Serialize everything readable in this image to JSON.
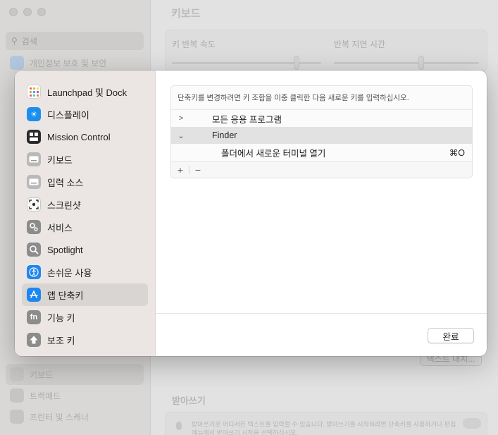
{
  "background": {
    "title": "키보드",
    "search_placeholder": "검색",
    "sidebar_top_item": "개인정보 보호 및 보안",
    "sidebar_bottom_items": [
      "키보드",
      "트랙패드",
      "프린터 및 스캐너"
    ],
    "key_repeat_label": "키 반복 속도",
    "repeat_delay_label": "반복 지연 시간",
    "text_replace_button": "텍스트 대치...",
    "dictation_section": "받아쓰기",
    "dictation_text": "받아쓰기로 어디서든 텍스트를 입력할 수 있습니다. 받아쓰기를 시작하려면 단축키를 사용하거나 편집 메뉴에서 받아쓰기 시작을 선택하십시오."
  },
  "sidebar": {
    "items": [
      {
        "label": "Launchpad 및 Dock",
        "icon": "launchpad-icon",
        "selected": false
      },
      {
        "label": "디스플레이",
        "icon": "display-icon",
        "selected": false
      },
      {
        "label": "Mission Control",
        "icon": "mission-control-icon",
        "selected": false
      },
      {
        "label": "키보드",
        "icon": "keyboard-icon",
        "selected": false
      },
      {
        "label": "입력 소스",
        "icon": "input-sources-icon",
        "selected": false
      },
      {
        "label": "스크린샷",
        "icon": "screenshot-icon",
        "selected": false
      },
      {
        "label": "서비스",
        "icon": "services-icon",
        "selected": false
      },
      {
        "label": "Spotlight",
        "icon": "spotlight-icon",
        "selected": false
      },
      {
        "label": "손쉬운 사용",
        "icon": "accessibility-icon",
        "selected": false
      },
      {
        "label": "앱 단축키",
        "icon": "app-shortcuts-icon",
        "selected": true
      },
      {
        "label": "기능 키",
        "icon": "function-keys-icon",
        "selected": false
      },
      {
        "label": "보조 키",
        "icon": "modifier-keys-icon",
        "selected": false
      }
    ],
    "fn_glyph": "fn"
  },
  "shortcuts": {
    "hint": "단축키를 변경하려면 키 조합을 이중 클릭한 다음 새로운 키를 입력하십시오.",
    "groups": [
      {
        "chevron": ">",
        "label": "모든 응용 프로그램",
        "expanded": false
      },
      {
        "chevron": "⌄",
        "label": "Finder",
        "expanded": true
      }
    ],
    "children": [
      {
        "label": "폴더에서 새로운 터미널 열기",
        "key": "⌘O"
      }
    ],
    "add_label": "+",
    "remove_label": "−"
  },
  "footer": {
    "done_label": "완료"
  },
  "colors": {
    "accent": "#1e86f0",
    "selected_row": "#e2e2e2",
    "sidebar_bg": "#ebe6e3"
  }
}
